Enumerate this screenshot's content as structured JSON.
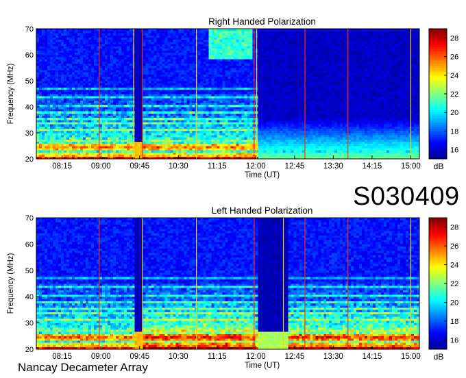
{
  "page": {
    "stamp": "S030409",
    "observatory": "Nancay Decameter Array"
  },
  "colormap": [
    "#00008f",
    "#0000ff",
    "#0080ff",
    "#00ffff",
    "#80ff80",
    "#ffff00",
    "#ff8000",
    "#ff0000",
    "#800000"
  ],
  "chart_data": [
    {
      "type": "heatmap",
      "title": "Right Handed Polarization",
      "xlabel": "Time (UT)",
      "ylabel": "Frequency (MHz)",
      "x_ticks": [
        "08:15",
        "09:00",
        "09:45",
        "10:30",
        "11:15",
        "12:00",
        "12:45",
        "13:30",
        "14:15",
        "15:00"
      ],
      "x_range": [
        "07:45",
        "15:10"
      ],
      "ylim": [
        20,
        70
      ],
      "y_ticks": [
        20,
        30,
        40,
        50,
        60,
        70
      ],
      "colorbar": {
        "label": "dB",
        "range": [
          15,
          29
        ],
        "ticks": [
          16,
          18,
          20,
          22,
          24,
          26,
          28
        ]
      },
      "marker_lines": [
        {
          "time": "08:58",
          "color": "#ff3000"
        },
        {
          "time": "09:38",
          "color": "#ffd000"
        },
        {
          "time": "09:48",
          "color": "#ff3000"
        },
        {
          "time": "10:51",
          "color": "#ffd000"
        },
        {
          "time": "11:58",
          "color": "#ff3000"
        },
        {
          "time": "12:01",
          "color": "#ffd000"
        },
        {
          "time": "12:57",
          "color": "#ff3000"
        },
        {
          "time": "13:47",
          "color": "#ff3000"
        },
        {
          "time": "15:00",
          "color": "#ffd000"
        }
      ]
    },
    {
      "type": "heatmap",
      "title": "Left Handed Polarization",
      "xlabel": "Time (UT)",
      "ylabel": "Frequency (MHz)",
      "x_ticks": [
        "08:15",
        "09:00",
        "09:45",
        "10:30",
        "11:15",
        "12:00",
        "12:45",
        "13:30",
        "14:15",
        "15:00"
      ],
      "x_range": [
        "07:45",
        "15:10"
      ],
      "ylim": [
        20,
        70
      ],
      "y_ticks": [
        20,
        30,
        40,
        50,
        60,
        70
      ],
      "colorbar": {
        "label": "dB",
        "range": [
          15,
          29
        ],
        "ticks": [
          16,
          18,
          20,
          22,
          24,
          26,
          28
        ]
      },
      "marker_lines": [
        {
          "time": "08:58",
          "color": "#ff3000"
        },
        {
          "time": "09:48",
          "color": "#ffd000"
        },
        {
          "time": "10:51",
          "color": "#ffd000"
        },
        {
          "time": "11:58",
          "color": "#ff3000"
        },
        {
          "time": "12:32",
          "color": "#ffd000"
        },
        {
          "time": "12:57",
          "color": "#ff3000"
        },
        {
          "time": "13:47",
          "color": "#ff3000"
        },
        {
          "time": "15:00",
          "color": "#ffd000"
        }
      ]
    }
  ]
}
